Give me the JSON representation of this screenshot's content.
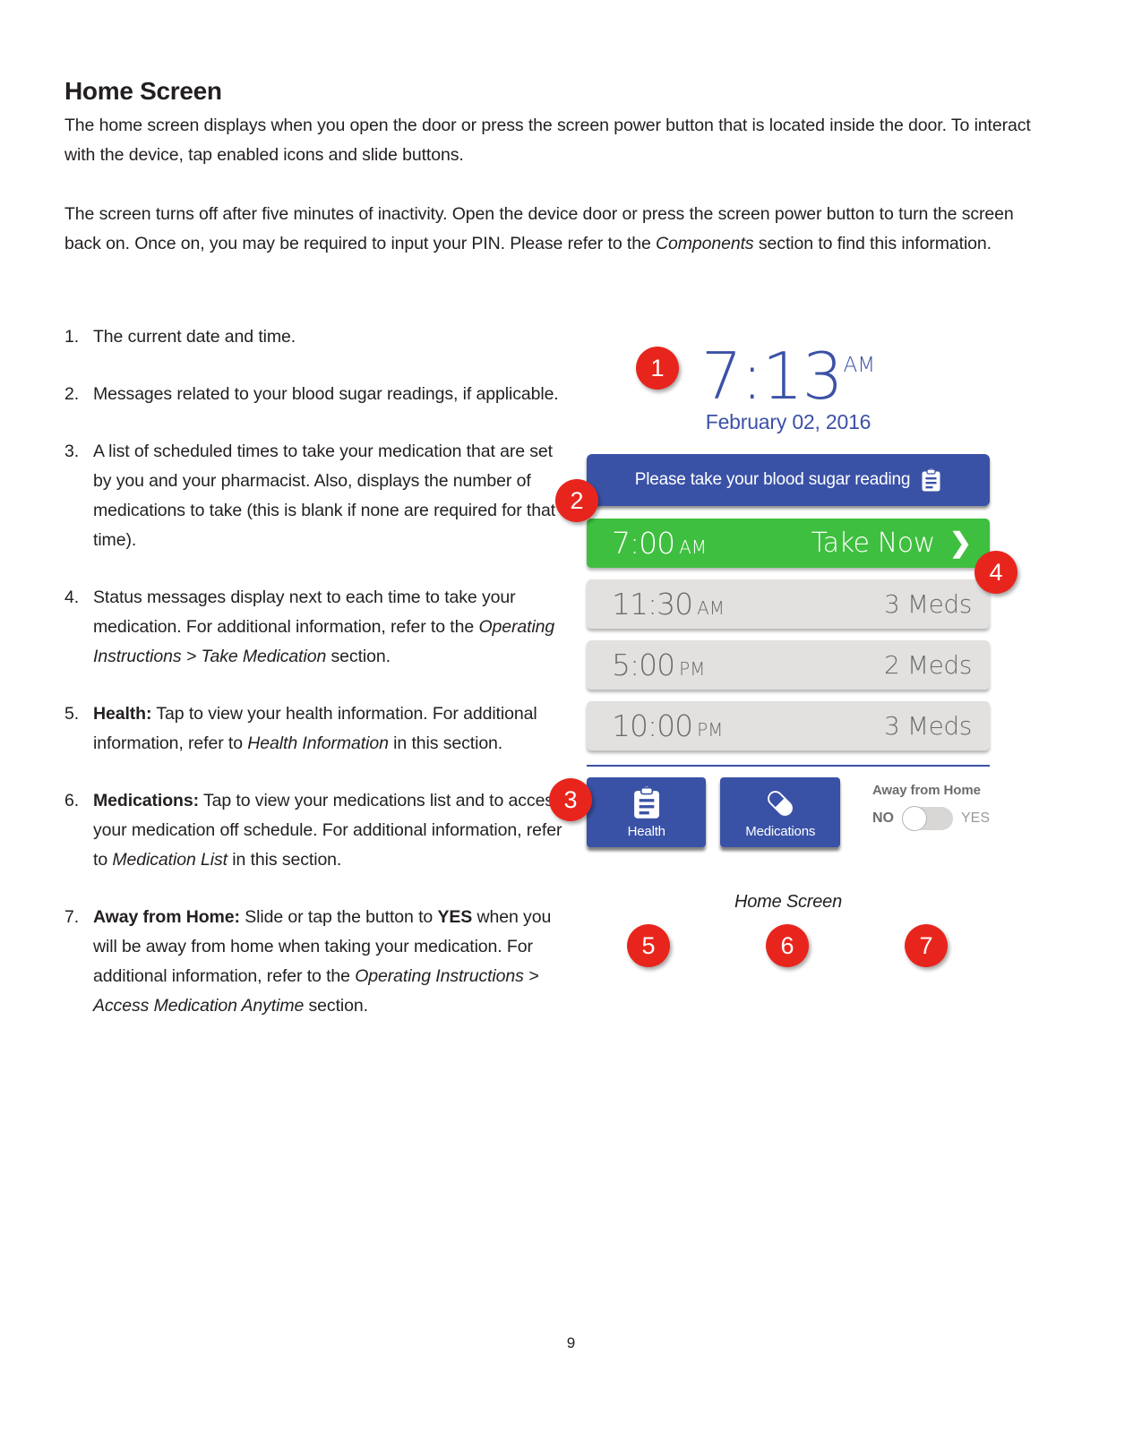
{
  "document": {
    "page_number": "9",
    "heading": "Home Screen",
    "paragraphs": [
      "The home screen displays when you open the door or press the screen power button that is located inside the door. To interact with the device, tap enabled icons and slide buttons.",
      "The screen turns off after five minutes of inactivity. Open the device door or press the screen power button to turn the screen back on.  Once on, you may be required to input your PIN.  Please refer to the Components section to find this information."
    ],
    "paragraph2_parts": {
      "a": "The screen turns off after five minutes of inactivity. Open the device door or press the screen power button to turn the screen back on.  Once on, you may be required to input your PIN.  Please refer to the ",
      "italic": "Components",
      "b": " section to find this information."
    },
    "caption": "Home Screen"
  },
  "steps": [
    {
      "num": "1.",
      "text": "The current date and time."
    },
    {
      "num": "2.",
      "text": "Messages related to your blood sugar readings, if applicable."
    },
    {
      "num": "3.",
      "text": "A list of scheduled times to take your medication that are set by you and your  pharmacist.  Also, displays the number of medications to take (this is blank if none are required for that time)."
    },
    {
      "num": "4.",
      "lead": "",
      "a": "Status messages display next to each time to take your medication. For additional information, refer to the ",
      "italic": "Operating Instructions > Take Medication",
      "b": " section."
    },
    {
      "num": "5.",
      "lead": "Health:",
      "a": " Tap to view your health information. For additional information, refer to ",
      "italic": "Health Information",
      "b": " in this section."
    },
    {
      "num": "6.",
      "lead": "Medications:",
      "a": " Tap to view your medications list and to access your medication off schedule. For additional information, refer to ",
      "italic": "Medication List",
      "b": " in this section."
    },
    {
      "num": "7.",
      "lead": "Away from Home:",
      "a": " Slide or tap the button to ",
      "bold2": "YES",
      "a2": " when you will be away from home when taking your medication. For additional information, refer to the ",
      "italic": "Operating Instructions > Access Medication Anytime",
      "b": " section."
    }
  ],
  "device": {
    "clock": {
      "time": "7:13",
      "meridiem": "AM",
      "date": "February 02, 2016"
    },
    "banner": {
      "message": "Please take your blood sugar reading",
      "icon": "clipboard-icon"
    },
    "schedule": [
      {
        "time": "7:00",
        "meridiem": "AM",
        "status": "Take Now",
        "state": "active",
        "chevron": "❯"
      },
      {
        "time": "11:30",
        "meridiem": "AM",
        "status": "3 Meds",
        "state": "idle",
        "chevron": ""
      },
      {
        "time": "5:00",
        "meridiem": "PM",
        "status": "2 Meds",
        "state": "idle",
        "chevron": ""
      },
      {
        "time": "10:00",
        "meridiem": "PM",
        "status": "3 Meds",
        "state": "idle",
        "chevron": ""
      }
    ],
    "tray": [
      {
        "label": "Health",
        "icon": "clipboard-icon"
      },
      {
        "label": "Medications",
        "icon": "pill-capsule-icon"
      }
    ],
    "away_from_home": {
      "title": "Away from Home",
      "off_label": "NO",
      "on_label": "YES",
      "value": "NO"
    }
  },
  "callouts": [
    {
      "id": "1",
      "label": "1"
    },
    {
      "id": "2",
      "label": "2"
    },
    {
      "id": "3",
      "label": "3"
    },
    {
      "id": "4",
      "label": "4"
    },
    {
      "id": "5",
      "label": "5"
    },
    {
      "id": "6",
      "label": "6"
    },
    {
      "id": "7",
      "label": "7"
    }
  ],
  "colors": {
    "brand_blue": "#3a52a6",
    "clock_blue": "#3c51a6",
    "active_green": "#3fbf3f",
    "idle_gray": "#e2e1df",
    "callout_red": "#e8251d",
    "text_black": "#231f20"
  }
}
